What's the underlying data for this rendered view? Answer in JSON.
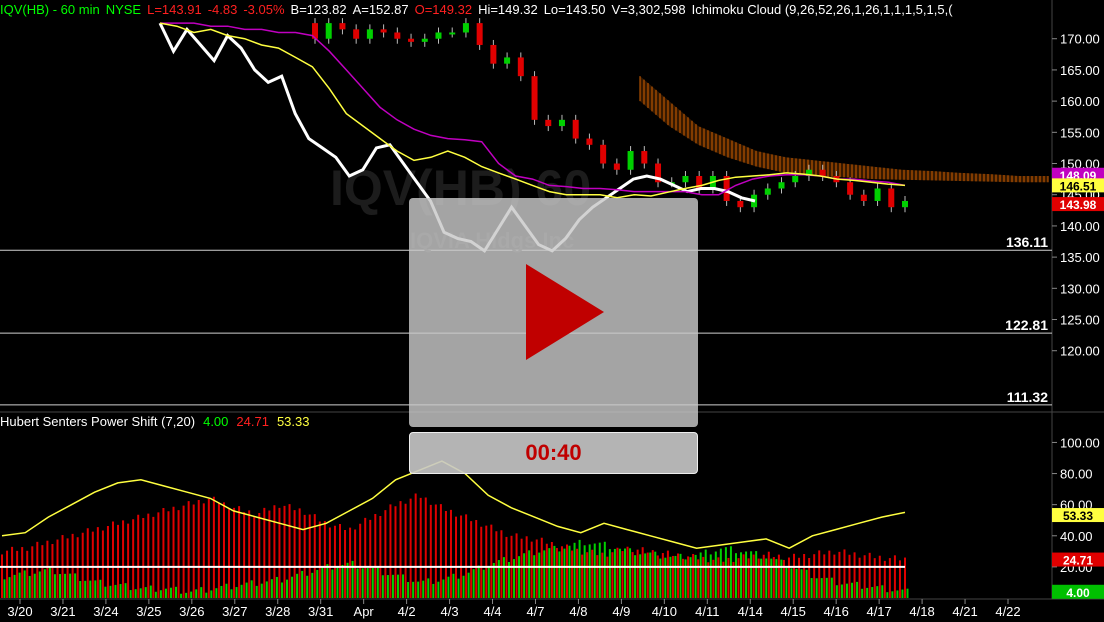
{
  "header": {
    "symbol": "IQV(HB) - 60 min",
    "exchange": "NYSE",
    "last": "L=143.91",
    "change": "-4.83",
    "change_pct": "-3.05%",
    "bid": "B=123.82",
    "ask": "A=152.87",
    "open": "O=149.32",
    "high": "Hi=149.32",
    "low": "Lo=143.50",
    "volume": "V=3,302,598",
    "study": "Ichimoku Cloud (9,26,52,26,1,26,1,1,1,5,1,5,("
  },
  "watermark": {
    "symbol": "IQV(HB) 60",
    "name": "IQVIA Hldgs Inc"
  },
  "price_axis": {
    "ticks": [
      "170.00",
      "165.00",
      "160.00",
      "155.00",
      "150.00",
      "145.00",
      "140.00",
      "135.00",
      "130.00",
      "125.00",
      "120.00"
    ],
    "tick_values": [
      170,
      165,
      160,
      155,
      150,
      145,
      140,
      135,
      130,
      125,
      120
    ],
    "ylim": [
      110.5,
      173
    ]
  },
  "levels": [
    {
      "label": "136.11",
      "value": 136.11
    },
    {
      "label": "122.81",
      "value": 122.81
    },
    {
      "label": "111.32",
      "value": 111.32
    }
  ],
  "price_tags": [
    {
      "label": "148.09",
      "value": 148.2,
      "color": "#c000c0"
    },
    {
      "label": "146.51",
      "value": 146.5,
      "color": "#ffff40"
    },
    {
      "label": "143.98",
      "value": 143.5,
      "color": "#e00000"
    }
  ],
  "indicator": {
    "title": "Hubert Senters Power Shift (7,20)",
    "green_value": "4.00",
    "red_value": "24.71",
    "yellow_value": "53.33",
    "ticks": [
      "100.00",
      "80.00",
      "60.00",
      "40.00",
      "20.00"
    ],
    "tick_values": [
      100,
      80,
      60,
      40,
      20
    ],
    "ylim": [
      0,
      108
    ],
    "tags": [
      {
        "label": "53.33",
        "value": 53.33,
        "color": "#ffff40"
      },
      {
        "label": "24.71",
        "value": 24.71,
        "color": "#e00000"
      },
      {
        "label": "4.00",
        "value": 4,
        "color": "#00c000"
      }
    ]
  },
  "time_axis": {
    "labels": [
      "3/20",
      "3/21",
      "3/24",
      "3/25",
      "3/26",
      "3/27",
      "3/28",
      "3/31",
      "Apr",
      "4/2",
      "4/3",
      "4/4",
      "4/7",
      "4/8",
      "4/9",
      "4/10",
      "4/11",
      "4/14",
      "4/15",
      "4/16",
      "4/17",
      "4/18",
      "4/21",
      "4/22"
    ]
  },
  "player": {
    "time": "00:40"
  },
  "colors": {
    "up": "#00d000",
    "down": "#e00000",
    "tenkan": "#ffff40",
    "kijun": "#c000c0",
    "lagging": "#ffffff",
    "cloud": "#d06000",
    "text_green": "#00ff00",
    "text_red": "#ff2020"
  },
  "chart_data": {
    "type": "line",
    "series": [
      {
        "values": [
          172.5,
          168,
          171.5,
          169,
          166.5,
          170.5,
          168.5,
          165,
          163,
          164,
          158,
          154,
          152.5,
          151,
          148,
          149,
          152.5,
          153,
          150,
          147,
          144,
          139,
          138,
          137.5,
          136,
          139.5,
          143,
          140,
          137,
          136,
          138,
          141,
          143,
          144.5,
          146,
          147.5,
          148,
          147.5,
          146.5,
          145.5,
          146,
          146,
          145.5,
          144.5,
          144
        ]
      },
      {
        "values": [
          172.5,
          172,
          171,
          171.5,
          170.5,
          170,
          169,
          168.5,
          167,
          165.5,
          162,
          158,
          156,
          154,
          152,
          150.5,
          151,
          152,
          151,
          149.5,
          148.5,
          147.5,
          146.5,
          145.5,
          145,
          145,
          145,
          144.5,
          145,
          144.8,
          145.4,
          146,
          146.5,
          147.3,
          147.8,
          148,
          148.2,
          148.5,
          148.3,
          148,
          147.5,
          147.3,
          147,
          146.7,
          146.5
        ]
      },
      {
        "values": [
          172.5,
          172.5,
          172.5,
          172,
          172,
          171.5,
          171.5,
          171,
          171,
          170.5,
          168,
          165,
          162,
          159,
          157,
          155.5,
          154.5,
          154,
          153.8,
          153.5,
          150,
          148,
          147.5,
          146.5,
          146.3,
          146,
          146,
          145.8,
          145.5,
          145.5,
          145.5,
          145.5,
          145,
          145,
          146.5,
          147.5,
          148,
          148.2,
          148.2,
          148,
          147.5,
          147.5,
          147.2,
          147,
          146.5
        ]
      },
      {
        "values": [
          172.5,
          170,
          172.5,
          171.5,
          170,
          171.5,
          171,
          170,
          169.5,
          170,
          171,
          171,
          172.5,
          169,
          166,
          167,
          164,
          157,
          156,
          157,
          154,
          153,
          150,
          149,
          152,
          150,
          147,
          147,
          148,
          146,
          148,
          144,
          143,
          145,
          146,
          147,
          148,
          149,
          148,
          147,
          145,
          144,
          146,
          143,
          144
        ]
      }
    ],
    "power_shift": {
      "yellow": [
        40,
        42,
        52,
        60,
        68,
        74,
        76,
        72,
        68,
        64,
        56,
        52,
        48,
        44,
        48,
        56,
        64,
        76,
        82,
        88,
        80,
        66,
        58,
        52,
        46,
        42,
        48,
        44,
        40,
        36,
        32,
        34,
        36,
        38,
        32,
        40,
        44,
        48,
        52,
        55
      ],
      "red": [
        30,
        32,
        36,
        40,
        44,
        48,
        52,
        56,
        60,
        64,
        58,
        54,
        60,
        56,
        48,
        44,
        52,
        60,
        66,
        58,
        52,
        46,
        40,
        38,
        34,
        30,
        28,
        32,
        30,
        28,
        26,
        24,
        26,
        28,
        26,
        28,
        30,
        28,
        26,
        25
      ],
      "green": [
        14,
        16,
        18,
        14,
        10,
        8,
        6,
        6,
        4,
        6,
        8,
        10,
        12,
        16,
        20,
        22,
        18,
        14,
        10,
        12,
        16,
        22,
        26,
        30,
        32,
        36,
        34,
        30,
        28,
        26,
        28,
        32,
        30,
        26,
        20,
        14,
        10,
        8,
        6,
        4
      ]
    }
  }
}
